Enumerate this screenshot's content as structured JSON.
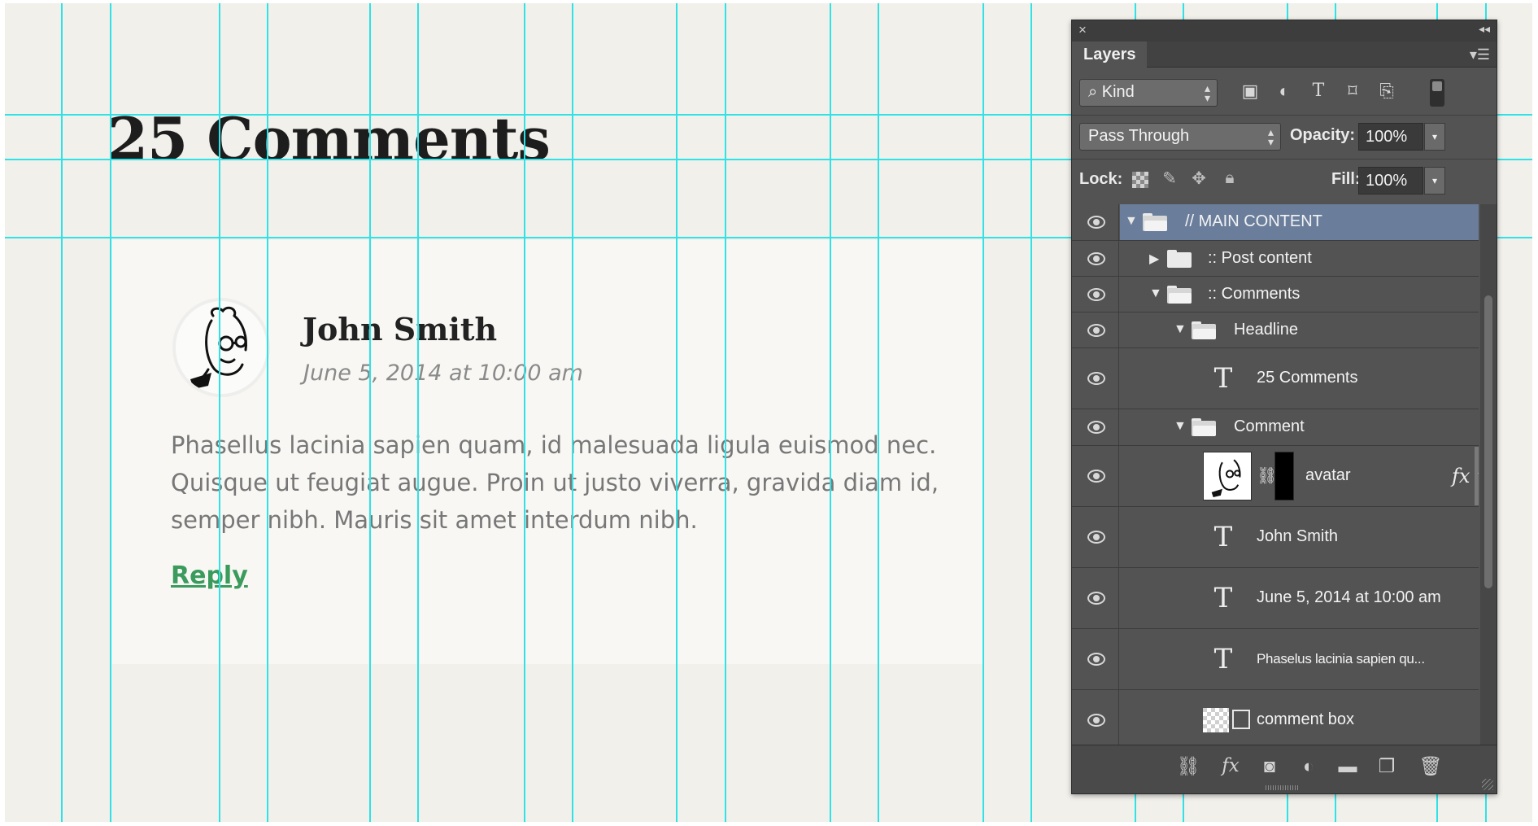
{
  "document": {
    "headline": "25 Comments",
    "comment": {
      "author": "John Smith",
      "date": "June 5, 2014 at 10:00 am",
      "body": "Phasellus lacinia sapien quam, id malesuada ligula euismod nec. Quisque ut feugiat augue. Proin ut justo viverra, gravida diam id, semper nibh. Mauris sit amet interdum nibh.",
      "reply_label": "Reply",
      "reply_color": "#3a9b5c"
    },
    "guide_color": "#2ee2e6",
    "background_color": "#f2f0eb"
  },
  "layers_panel": {
    "tab_label": "Layers",
    "kind_filter": "Kind",
    "blend_mode": "Pass Through",
    "opacity_label": "Opacity:",
    "opacity_value": "100%",
    "lock_label": "Lock:",
    "fill_label": "Fill:",
    "fill_value": "100%",
    "filter_icons": [
      "image-filter-icon",
      "adjustment-filter-icon",
      "type-filter-icon",
      "shape-filter-icon",
      "smart-object-filter-icon"
    ],
    "lock_icons": [
      "lock-transparent-pixels-icon",
      "lock-image-pixels-icon",
      "lock-position-icon",
      "lock-all-icon"
    ],
    "layers": [
      {
        "name": "// MAIN CONTENT",
        "kind": "group",
        "expanded": true,
        "selected": true
      },
      {
        "name": ":: Post content",
        "kind": "group",
        "expanded": false
      },
      {
        "name": ":: Comments",
        "kind": "group",
        "expanded": true
      },
      {
        "name": "Headline",
        "kind": "group",
        "expanded": true
      },
      {
        "name": "25 Comments",
        "kind": "type"
      },
      {
        "name": "Comment",
        "kind": "group",
        "expanded": true
      },
      {
        "name": "avatar",
        "kind": "smart-object",
        "has_mask": true,
        "has_fx": true,
        "fx_label": "fx"
      },
      {
        "name": "John Smith",
        "kind": "type"
      },
      {
        "name": "June 5, 2014 at 10:00 am",
        "kind": "type"
      },
      {
        "name": "Phaselus lacinia sapien qu...",
        "kind": "type"
      },
      {
        "name": "comment box",
        "kind": "shape"
      }
    ],
    "bottom_icons": [
      "link-layers-icon",
      "add-style-icon",
      "add-mask-icon",
      "new-adjustment-icon",
      "new-group-icon",
      "new-layer-icon",
      "delete-layer-icon"
    ],
    "selection_color": "#6a7e9c"
  }
}
